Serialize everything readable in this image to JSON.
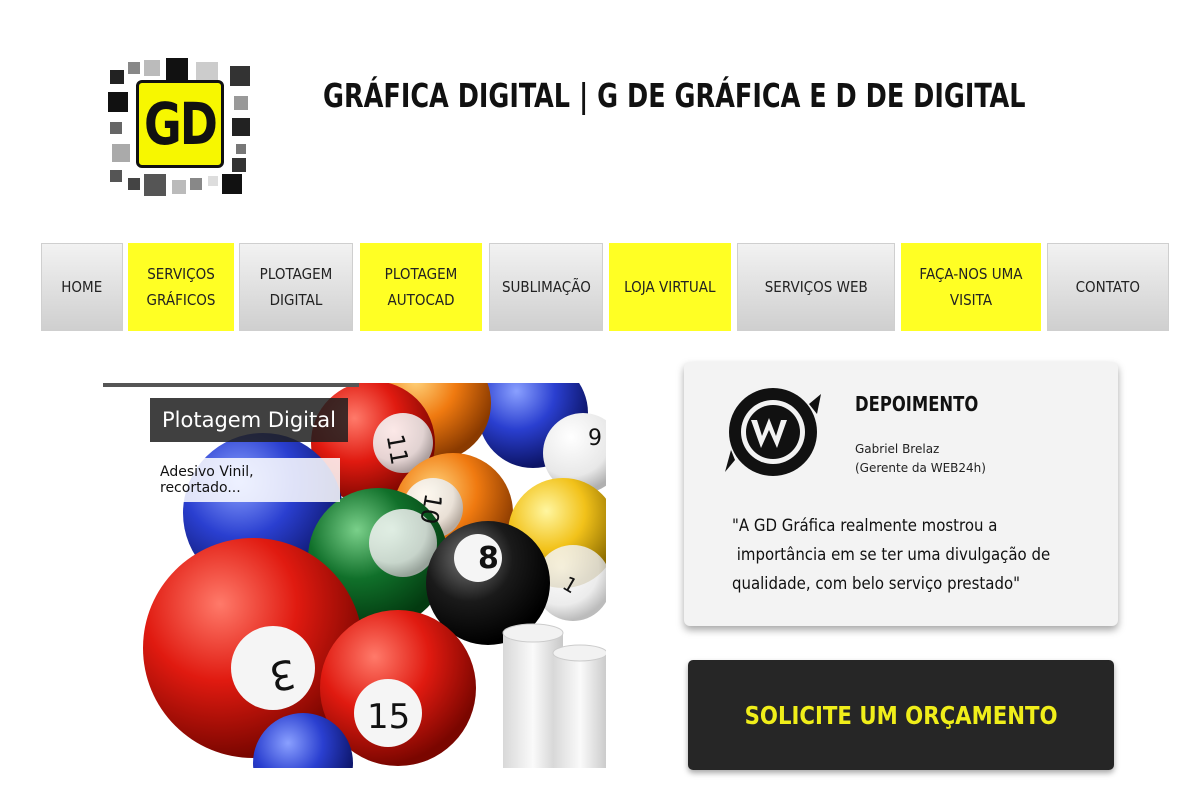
{
  "header": {
    "logo_text": "GD",
    "title": "GRÁFICA DIGITAL  |  G DE GRÁFICA E D DE DIGITAL"
  },
  "nav": {
    "items": [
      {
        "label": "HOME",
        "style": "gray"
      },
      {
        "label": "SERVIÇOS GRÁFICOS",
        "style": "yellow"
      },
      {
        "label": "PLOTAGEM DIGITAL",
        "style": "gray"
      },
      {
        "label": "PLOTAGEM AUTOCAD",
        "style": "yellow"
      },
      {
        "label": "SUBLIMAÇÃO",
        "style": "gray"
      },
      {
        "label": "LOJA VIRTUAL",
        "style": "yellow"
      },
      {
        "label": "SERVIÇOS WEB",
        "style": "gray"
      },
      {
        "label": "FAÇA-NOS UMA VISITA",
        "style": "yellow"
      },
      {
        "label": "CONTATO",
        "style": "gray"
      }
    ]
  },
  "slider": {
    "title": "Plotagem Digital",
    "caption": "Adesivo Vinil, recortado...",
    "balls": [
      "11",
      "10",
      "8",
      "9",
      "3",
      "15",
      "1"
    ]
  },
  "testimonial": {
    "heading": "DEPOIMENTO",
    "name": "Gabriel Brelaz",
    "role": "(Gerente da WEB24h)",
    "quote_lines": [
      "\"A GD Gráfica realmente mostrou a",
      " importância em se ter uma divulgação de",
      "qualidade, com belo serviço prestado\""
    ]
  },
  "cta": {
    "label": "SOLICITE UM ORÇAMENTO"
  },
  "colors": {
    "accent_yellow": "#ffff24",
    "nav_gray": "#dcdcdc",
    "cta_bg": "#262626",
    "cta_text": "#f0ee1a"
  }
}
